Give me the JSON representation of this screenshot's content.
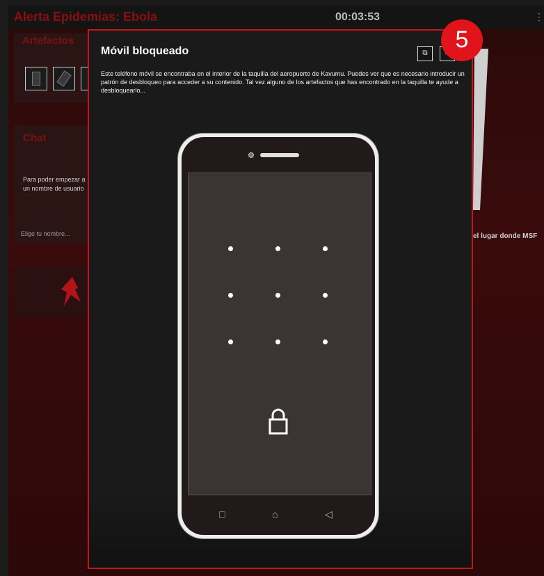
{
  "app": {
    "title": "Alerta Epidemias: Ebola",
    "timer": "00:03:53",
    "grid_icon": "grid-dots-icon"
  },
  "sidebar": {
    "artifacts_title": "Artefactos",
    "chat_title": "Chat",
    "chat_text_line1": "Para poder empezar a",
    "chat_text_line2": "un nombre de usuario",
    "chat_input_placeholder": "Elige tu nombre..."
  },
  "right_text": "el lugar donde MSF",
  "modal": {
    "title": "Móvil bloqueado",
    "description": "Este teléfono móvil se encontraba en el interior de la taquilla del aeropuerto de Kavumu. Puedes ver que es necesario introducir un patrón de desbloqueo para acceder a su contenido. Tal vez alguno de los artefactos que has encontrado en la taquilla te ayude a desbloquearlo...",
    "expand_icon": "expand-icon",
    "close_icon": "close-icon"
  },
  "phone": {
    "pattern_dots": 9,
    "lock_icon": "lock-icon",
    "nav": {
      "recent": "□",
      "home": "⌂",
      "back": "◁"
    }
  },
  "badge": "5",
  "colors": {
    "accent": "#c3161c",
    "badge": "#e2141b",
    "title_red": "#8a1010"
  }
}
